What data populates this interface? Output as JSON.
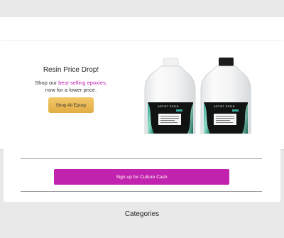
{
  "banner": {
    "title": "Resin Price Drop!",
    "copy_prefix": "Shop our ",
    "copy_highlight": "best-selling epoxies,",
    "copy_line2": "now for a lower price.",
    "shop_button_label": "Shop All Epoxy"
  },
  "product_labels": {
    "left": "ARTIST  RESIN",
    "right": "ARTIST  RESIN"
  },
  "signup": {
    "button_label": "Sign up for Culture Cash"
  },
  "categories": {
    "heading": "Categories"
  },
  "colors": {
    "accent_magenta": "#c223ae",
    "gold_button": "#e9bb55",
    "page_background": "#e9e9e9"
  }
}
